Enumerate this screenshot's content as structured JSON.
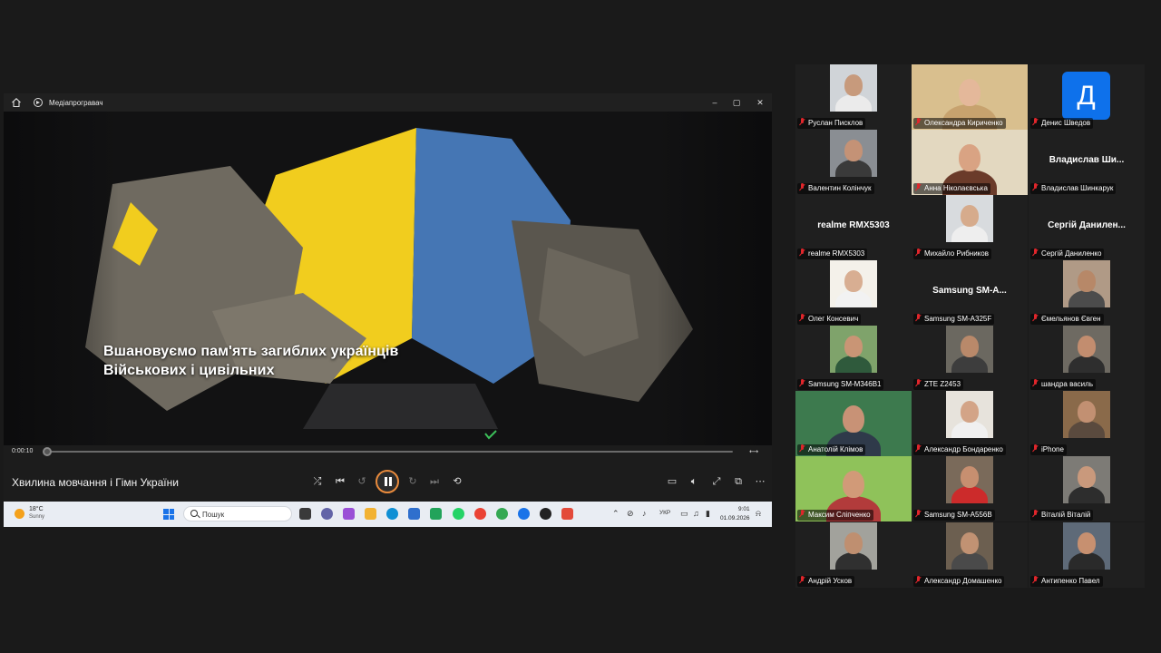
{
  "media_player": {
    "app_title": "Медіапрогравач",
    "window_buttons": {
      "minimize": "–",
      "maximize": "▢",
      "close": "✕"
    },
    "caption_line1": "Вшановуємо пам'ять загиблих українців",
    "caption_line2": "Військових і цивільних",
    "time_current": "0:00:10",
    "time_end": "⟷",
    "progress_fraction": 0.0,
    "media_title": "Хвилина мовчання і Гімн України",
    "state": "playing",
    "flag_colors": {
      "yellow": "#f6d31c",
      "blue": "#3f6fae"
    }
  },
  "taskbar": {
    "weather_temp": "18°C",
    "weather_condition": "Sunny",
    "search_placeholder": "Пошук",
    "language": "УКР",
    "clock_time": "9:01",
    "clock_date": "01.09.2026"
  },
  "participants": [
    {
      "name": "Руслан Писклов",
      "kind": "video",
      "skin": "#c79a7c",
      "shirt": "#ebebeb",
      "bg": "#d0d4d8"
    },
    {
      "name": "Олександра Кириченко",
      "kind": "fullvideo",
      "skin": "#e4b89a",
      "shirt": "#c7a26e",
      "bg": "#d9bf8e"
    },
    {
      "name": "Денис Шведов",
      "kind": "avatar",
      "initial": "Д"
    },
    {
      "name": "Валентин Колінчук",
      "kind": "video",
      "skin": "#c49276",
      "shirt": "#3a3a3a",
      "bg": "#8a8e93"
    },
    {
      "name": "Анна Ніколаєвська",
      "kind": "fullvideo",
      "skin": "#d9a383",
      "shirt": "#6b3b2a",
      "bg": "#e3d8c0",
      "active": true
    },
    {
      "name": "Владислав Шинкарук",
      "kind": "name",
      "display": "Владислав  Ши..."
    },
    {
      "name": "realme RMX5303",
      "kind": "name",
      "display": "realme RMX5303"
    },
    {
      "name": "Михайло Рибников",
      "kind": "video",
      "skin": "#d6ab8c",
      "shirt": "#eeeeee",
      "bg": "#d8dbde"
    },
    {
      "name": "Сергій Даниленко",
      "kind": "name",
      "display": "Сергій  Данилен..."
    },
    {
      "name": "Олег Консевич",
      "kind": "video",
      "skin": "#d8ae92",
      "shirt": "#f2f2f2",
      "bg": "#f4f1ea"
    },
    {
      "name": "Samsung SM-A325F",
      "kind": "name",
      "display": "Samsung  SM-A..."
    },
    {
      "name": "Ємельянов Євген",
      "kind": "video",
      "skin": "#b78868",
      "shirt": "#4c4c4c",
      "bg": "#b09a86"
    },
    {
      "name": "Samsung SM-M346B1",
      "kind": "video",
      "skin": "#c99575",
      "shirt": "#2f5a3c",
      "bg": "#7fa36b"
    },
    {
      "name": "ZTE Z2453",
      "kind": "video",
      "skin": "#b9896a",
      "shirt": "#3d3d3d",
      "bg": "#6b6860"
    },
    {
      "name": "шандра василь",
      "kind": "video",
      "skin": "#c28d6f",
      "shirt": "#2e2e2e",
      "bg": "#6e6a62"
    },
    {
      "name": "Анатолій Клімов",
      "kind": "fullvideo",
      "skin": "#c89276",
      "shirt": "#2f3a4a",
      "bg": "#3d7a4e"
    },
    {
      "name": "Александр Бондаренко",
      "kind": "video",
      "skin": "#d3a487",
      "shirt": "#f0f0f0",
      "bg": "#e7e3dc"
    },
    {
      "name": "iPhone",
      "kind": "video",
      "skin": "#c29072",
      "shirt": "#5a4a3e",
      "bg": "#8a6a4a"
    },
    {
      "name": "Максим Сліпченко",
      "kind": "fullvideo",
      "skin": "#d19a78",
      "shirt": "#b23b3b",
      "bg": "#8fc25a"
    },
    {
      "name": "Samsung SM-A556B",
      "kind": "video",
      "skin": "#c78f70",
      "shirt": "#cc2b2b",
      "bg": "#7a6a5a"
    },
    {
      "name": "Віталій Віталій",
      "kind": "video",
      "skin": "#c9997c",
      "shirt": "#2d2d2d",
      "bg": "#7d7b76"
    },
    {
      "name": "Андрій Усков",
      "kind": "video",
      "skin": "#bf8f70",
      "shirt": "#303030",
      "bg": "#a2a29c"
    },
    {
      "name": "Александр Домашенко",
      "kind": "video",
      "skin": "#c19273",
      "shirt": "#4a4a4a",
      "bg": "#6c5f50"
    },
    {
      "name": "Антипенко Павел",
      "kind": "video",
      "skin": "#c79070",
      "shirt": "#2a2a2a",
      "bg": "#5e6a78"
    }
  ]
}
